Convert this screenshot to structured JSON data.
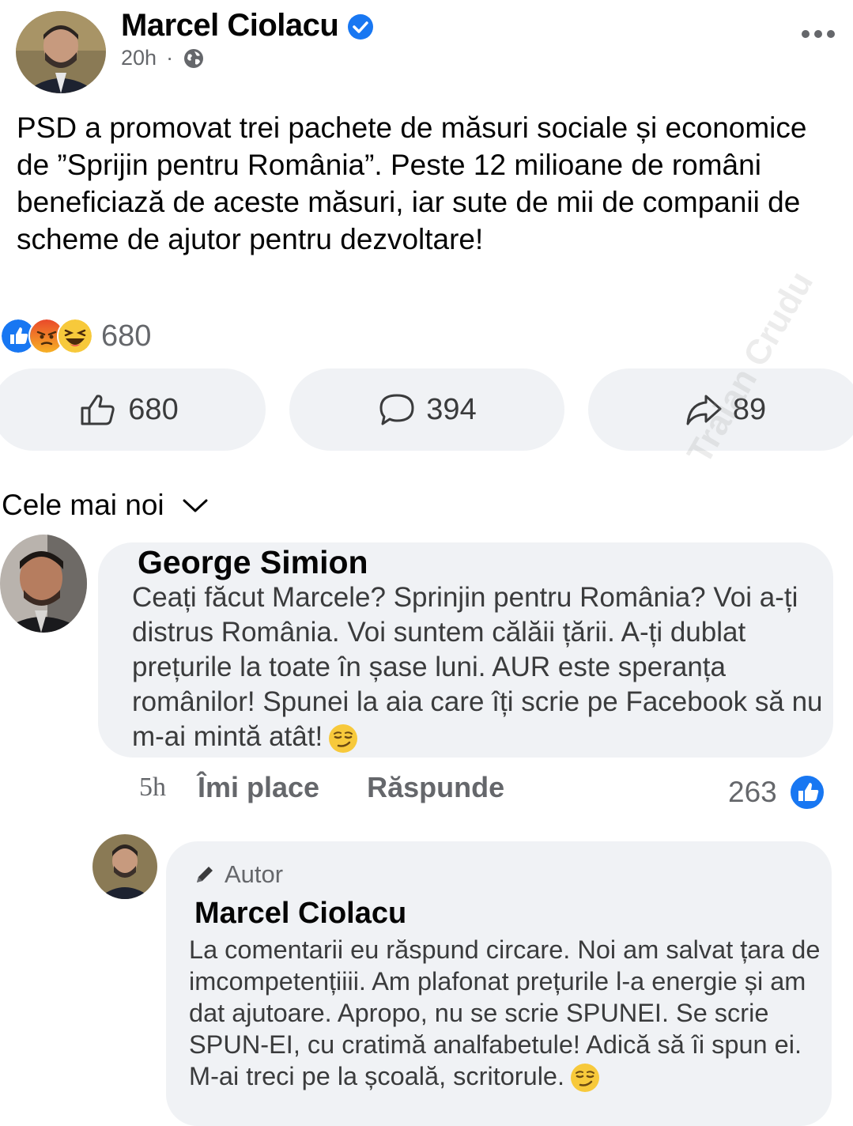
{
  "post": {
    "author": "Marcel Ciolacu",
    "time": "20h",
    "separator": "·",
    "text": "PSD a promovat trei pachete de măsuri sociale și economice de ”Sprijin pentru România”. Peste 12 milioane de români beneficiază de aceste măsuri, iar sute de mii de companii de scheme de ajutor pentru dezvoltare!",
    "reaction_count": "680",
    "icons": [
      "verified-icon",
      "globe-icon",
      "more-icon",
      "like-reaction-icon",
      "angry-reaction-icon",
      "haha-reaction-icon"
    ]
  },
  "actions": {
    "like": "680",
    "comment": "394",
    "share": "89"
  },
  "sort_label": "Cele mai noi",
  "watermark": "Traian Crudu",
  "comments": [
    {
      "author": "George Simion",
      "text": "Ceați făcut Marcele? Sprinjin pentru România? Voi a-ți distrus România. Voi suntem călăii țării. A-ți dublat prețurile la toate în șase luni. AUR este speranța românilor! Spunei la aia care îți scrie pe Facebook să nu m-ai mintă atât!",
      "time": "5h",
      "like_label": "Îmi place",
      "reply_label": "Răspunde",
      "like_count": "263"
    },
    {
      "badge": "Autor",
      "author": "Marcel Ciolacu",
      "text": "La comentarii eu răspund circare. Noi am salvat țara de imcompetențiiii. Am plafonat prețurile l-a energie și am dat ajutoare. Apropo, nu se scrie SPUNEI. Se scrie SPUN-EI, cu cratimă analfabetule! Adică să îi spun ei. M-ai treci pe la școală, scritorule."
    }
  ],
  "colors": {
    "accent_blue": "#1877f2",
    "bubble_bg": "#f0f2f5",
    "secondary_text": "#65676b"
  }
}
